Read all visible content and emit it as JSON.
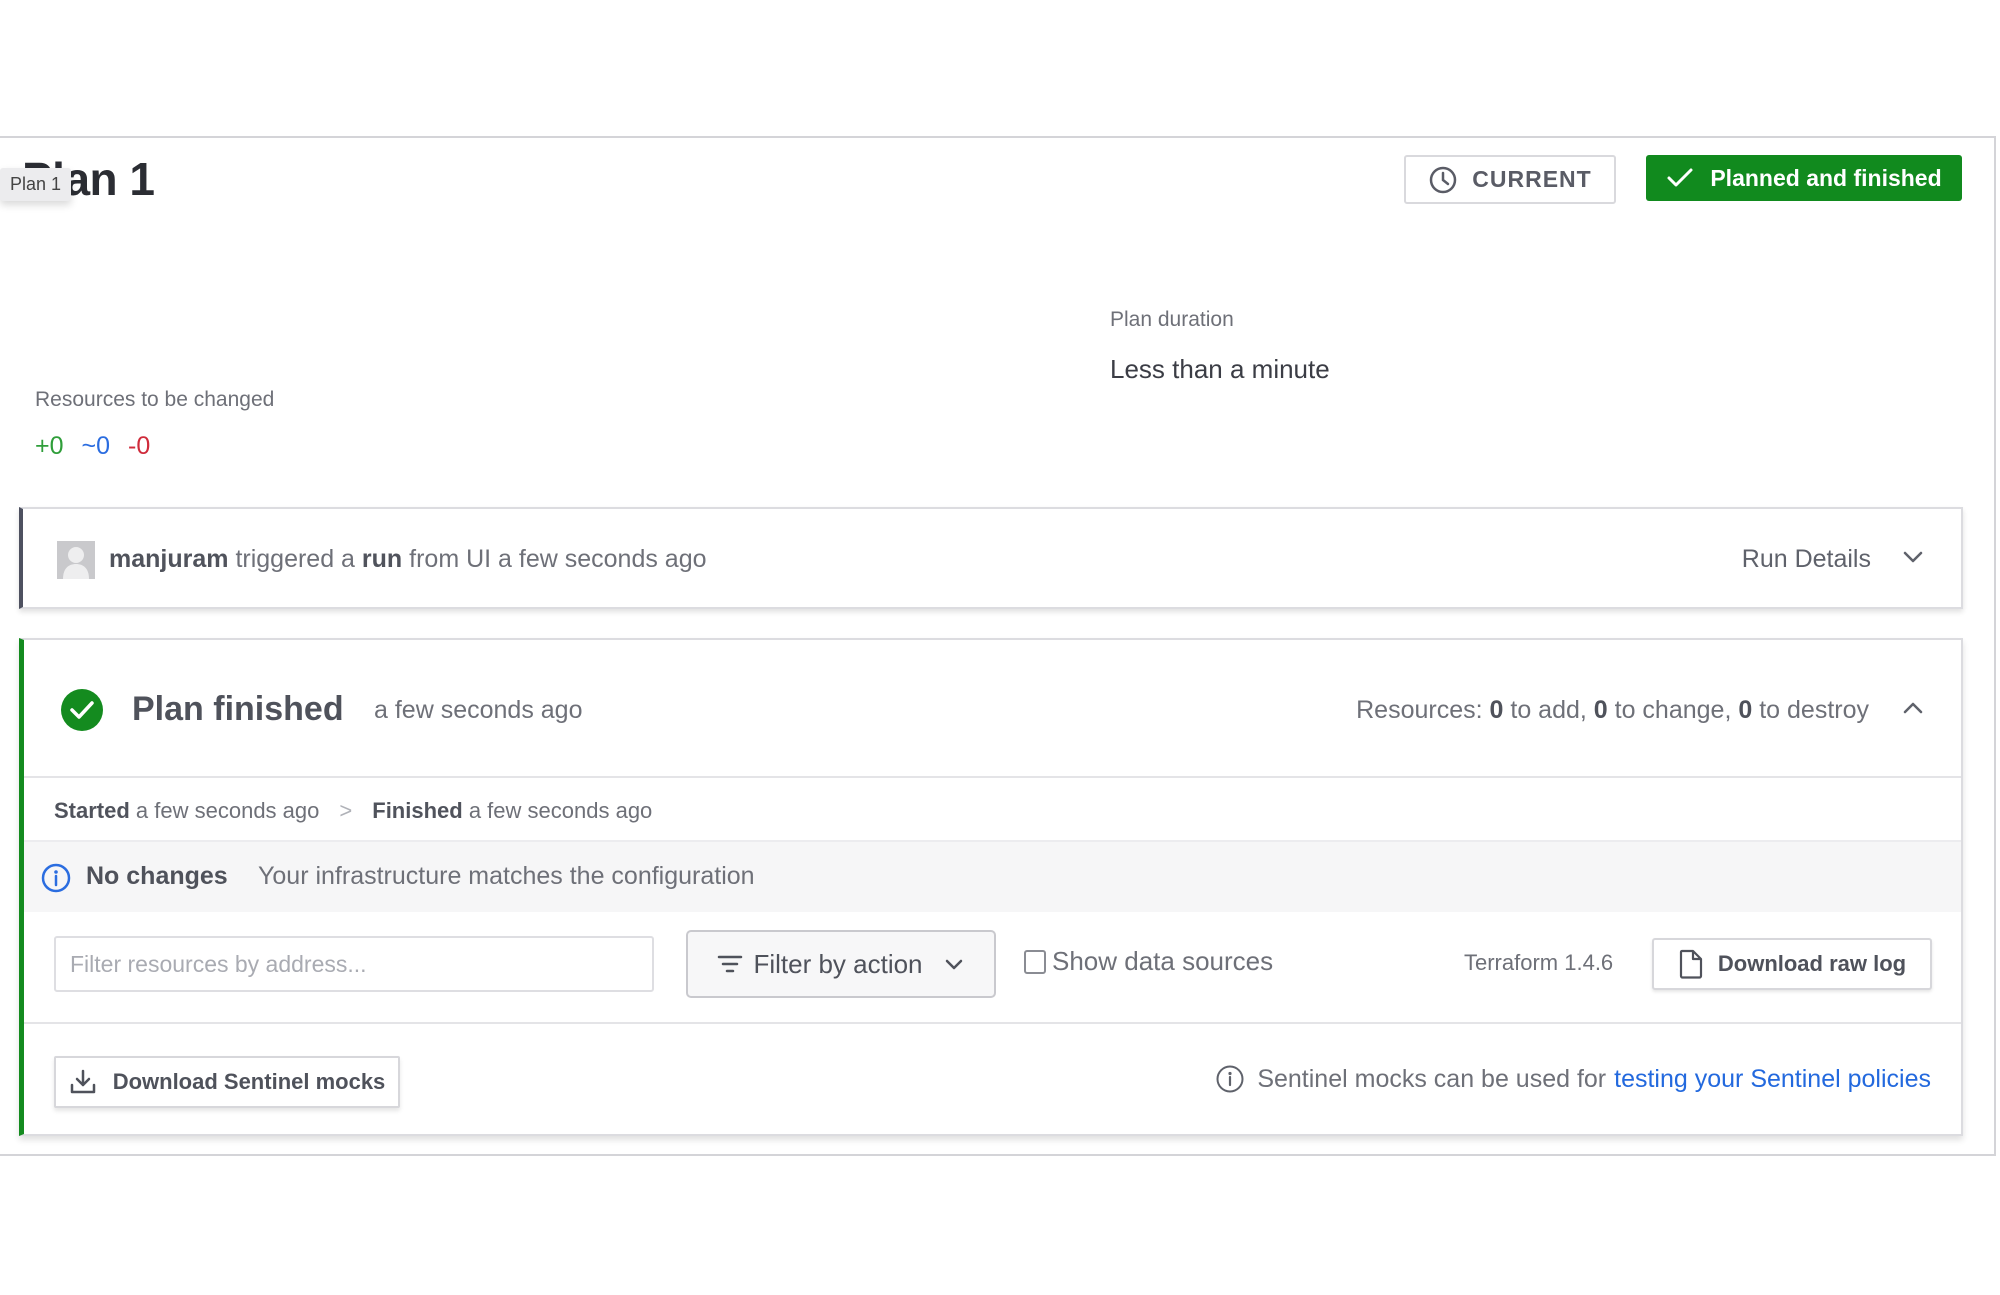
{
  "header": {
    "title": "Plan 1",
    "tooltip": "Plan 1",
    "current_badge": {
      "icon": "clock-icon",
      "label": "CURRENT"
    },
    "status_badge": {
      "icon": "check-icon",
      "label": "Planned and finished",
      "color": "#118a1e"
    }
  },
  "summary": {
    "resources_label": "Resources to be changed",
    "counts": {
      "add": "+0",
      "change": "~0",
      "destroy": "-0"
    },
    "colors": {
      "add": "#2f9e3a",
      "change": "#2b6de0",
      "destroy": "#cf2b3b"
    },
    "duration_label": "Plan duration",
    "duration_value": "Less than a minute"
  },
  "run": {
    "user": "manjuram",
    "text_1": "triggered a",
    "run_word": "run",
    "text_2": "from UI a few seconds ago",
    "details_label": "Run Details"
  },
  "plan": {
    "title": "Plan finished",
    "time": "a few seconds ago",
    "resources_prefix": "Resources:",
    "add_count": "0",
    "add_text": "to add,",
    "change_count": "0",
    "change_text": "to change,",
    "destroy_count": "0",
    "destroy_text": "to destroy",
    "timeline": {
      "started_label": "Started",
      "started_time": "a few seconds ago",
      "separator": ">",
      "finished_label": "Finished",
      "finished_time": "a few seconds ago"
    },
    "notice": {
      "title": "No changes",
      "text": "Your infrastructure matches the configuration"
    },
    "toolbar": {
      "filter_placeholder": "Filter resources by address...",
      "filter_value": "",
      "filter_action_label": "Filter by action",
      "show_data_sources_label": "Show data sources",
      "show_data_sources_checked": false,
      "terraform_version": "Terraform 1.4.6",
      "download_raw_log_label": "Download raw log"
    },
    "sentinel": {
      "download_label": "Download Sentinel mocks",
      "note_text": "Sentinel mocks can be used for",
      "note_link": "testing your Sentinel policies"
    }
  }
}
